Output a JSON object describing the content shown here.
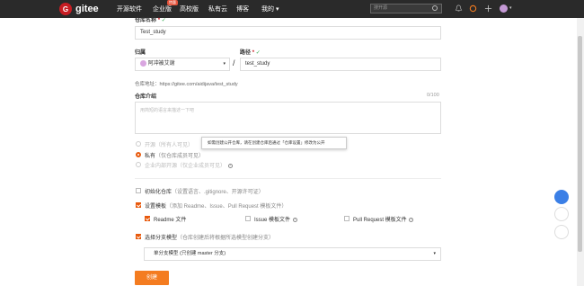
{
  "nav": {
    "logo_letter": "G",
    "logo_text": "gitee",
    "items": [
      "开源软件",
      "企业版",
      "高校版",
      "私有云",
      "博客",
      "我的"
    ],
    "enterprise_badge": "特惠",
    "search_placeholder": "搜开源"
  },
  "form": {
    "repo_name_label": "仓库名称",
    "repo_name_value": "Test_study",
    "owner_label": "归属",
    "owner_value": "阿冲被艾谢",
    "path_label": "路径",
    "path_value": "test_study",
    "separator": "/",
    "repo_url": "仓库地址：https://gitee.com/aidijava/test_study",
    "intro_label": "仓库介绍",
    "intro_counter": "0/100",
    "intro_placeholder": "用简短的语言来描述一下吧",
    "visibility": {
      "public_label": "开源",
      "public_note": "（所有人可见）",
      "private_label": "私有",
      "private_note": "（仅仓库成员可见）",
      "internal_label": "企业内部开源",
      "internal_note": "（仅企业成员可见）"
    },
    "tooltip": "如需创建公开仓库，请在创建仓库后通过「仓库设置」修改为公开",
    "init_label": "初始化仓库",
    "init_note": "（设置语言、.gitignore、开源许可证）",
    "template_label": "设置模板",
    "template_note": "（添加 Readme、Issue、Pull Request 模板文件）",
    "readme_label": "Readme 文件",
    "issue_label": "Issue 模板文件",
    "pr_label": "Pull Request 模板文件",
    "branch_label": "选择分支模型",
    "branch_note": "（仓库创建后将根据所选模型创建分支）",
    "branch_select": "单分支模型 (只创建 master 分支)",
    "create_button": "创建",
    "checkmark": "✓",
    "required": "*",
    "info_mark": "?"
  },
  "colors": {
    "brand_red": "#c71d23",
    "accent_orange": "#f47c20",
    "nav_bg": "#2a2a2a"
  }
}
